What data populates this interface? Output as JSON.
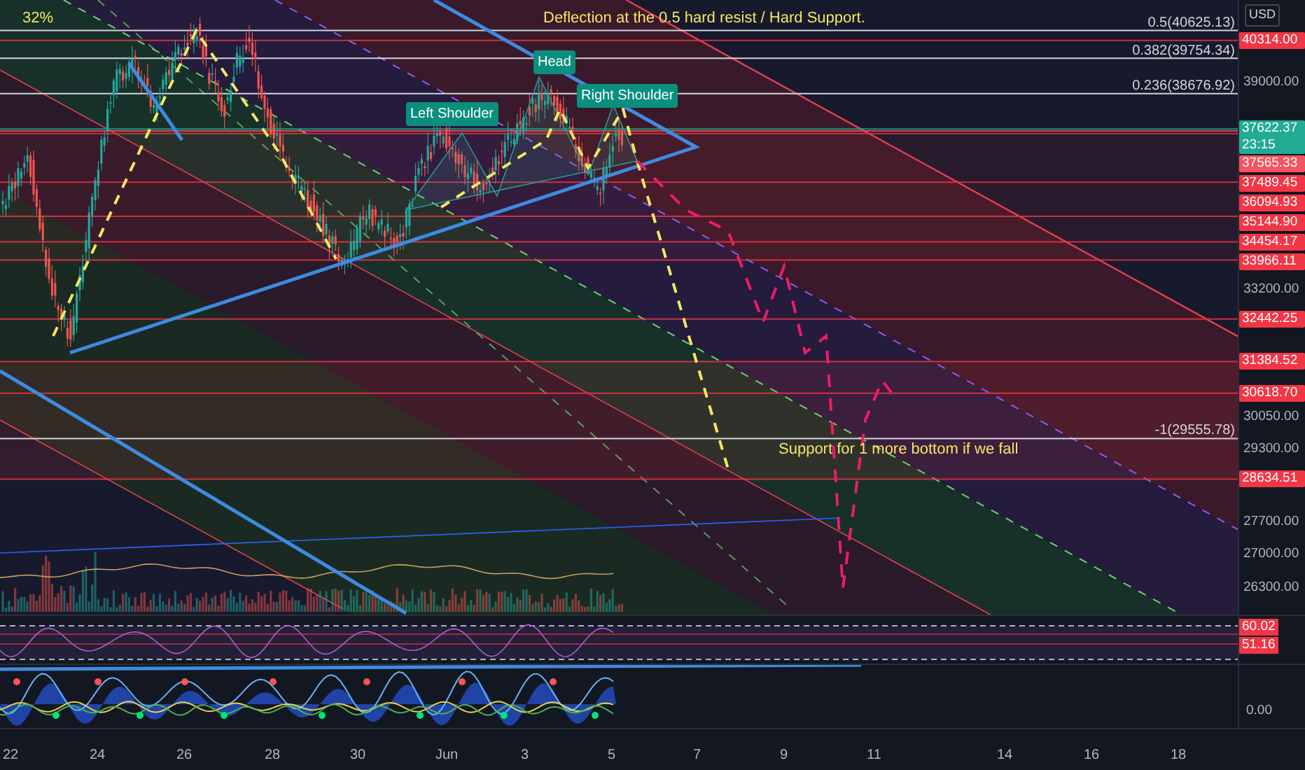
{
  "chart": {
    "percent_label": "32%",
    "notes": [
      "Deflection at the 0.5 hard resist / Hard Support.",
      "Support for 1 more bottom if we fall"
    ],
    "pattern_labels": [
      "Left Shoulder",
      "Head",
      "Right Shoulder"
    ],
    "fib_levels": [
      "0.5(40625.13)",
      "0.382(39754.34)",
      "0.236(38676.92)",
      "-1(29555.78)"
    ]
  },
  "price_axis": {
    "currency": "USD",
    "ticks": [
      "39000.00",
      "33200.00",
      "30050.00",
      "29300.00",
      "27700.00",
      "27000.00",
      "26300.00"
    ],
    "price_labels": [
      {
        "value": "40314.00",
        "color": "#f23645"
      },
      {
        "value": "37622.37",
        "sub": "23:15",
        "color": "#22ab94"
      },
      {
        "value": "37565.33",
        "color": "#f7525f"
      },
      {
        "value": "37489.45",
        "color": "#f23645"
      },
      {
        "value": "36094.93",
        "color": "#f23645"
      },
      {
        "value": "35144.90",
        "color": "#f23645"
      },
      {
        "value": "34454.17",
        "color": "#f23645"
      },
      {
        "value": "33966.11",
        "color": "#f23645"
      },
      {
        "value": "32442.25",
        "color": "#f23645"
      },
      {
        "value": "31384.52",
        "color": "#f23645"
      },
      {
        "value": "30618.70",
        "color": "#f23645"
      },
      {
        "value": "28634.51",
        "color": "#f23645"
      }
    ]
  },
  "rsi_pane": {
    "labels": [
      {
        "value": "60.02",
        "color": "#f23645"
      },
      {
        "value": "51.16",
        "color": "#f23645"
      }
    ]
  },
  "oscillator_pane": {
    "ticks": [
      "0.00"
    ]
  },
  "time_axis": {
    "labels": [
      "22",
      "24",
      "26",
      "28",
      "30",
      "Jun",
      "3",
      "5",
      "7",
      "9",
      "11",
      "14",
      "16",
      "18"
    ]
  }
}
